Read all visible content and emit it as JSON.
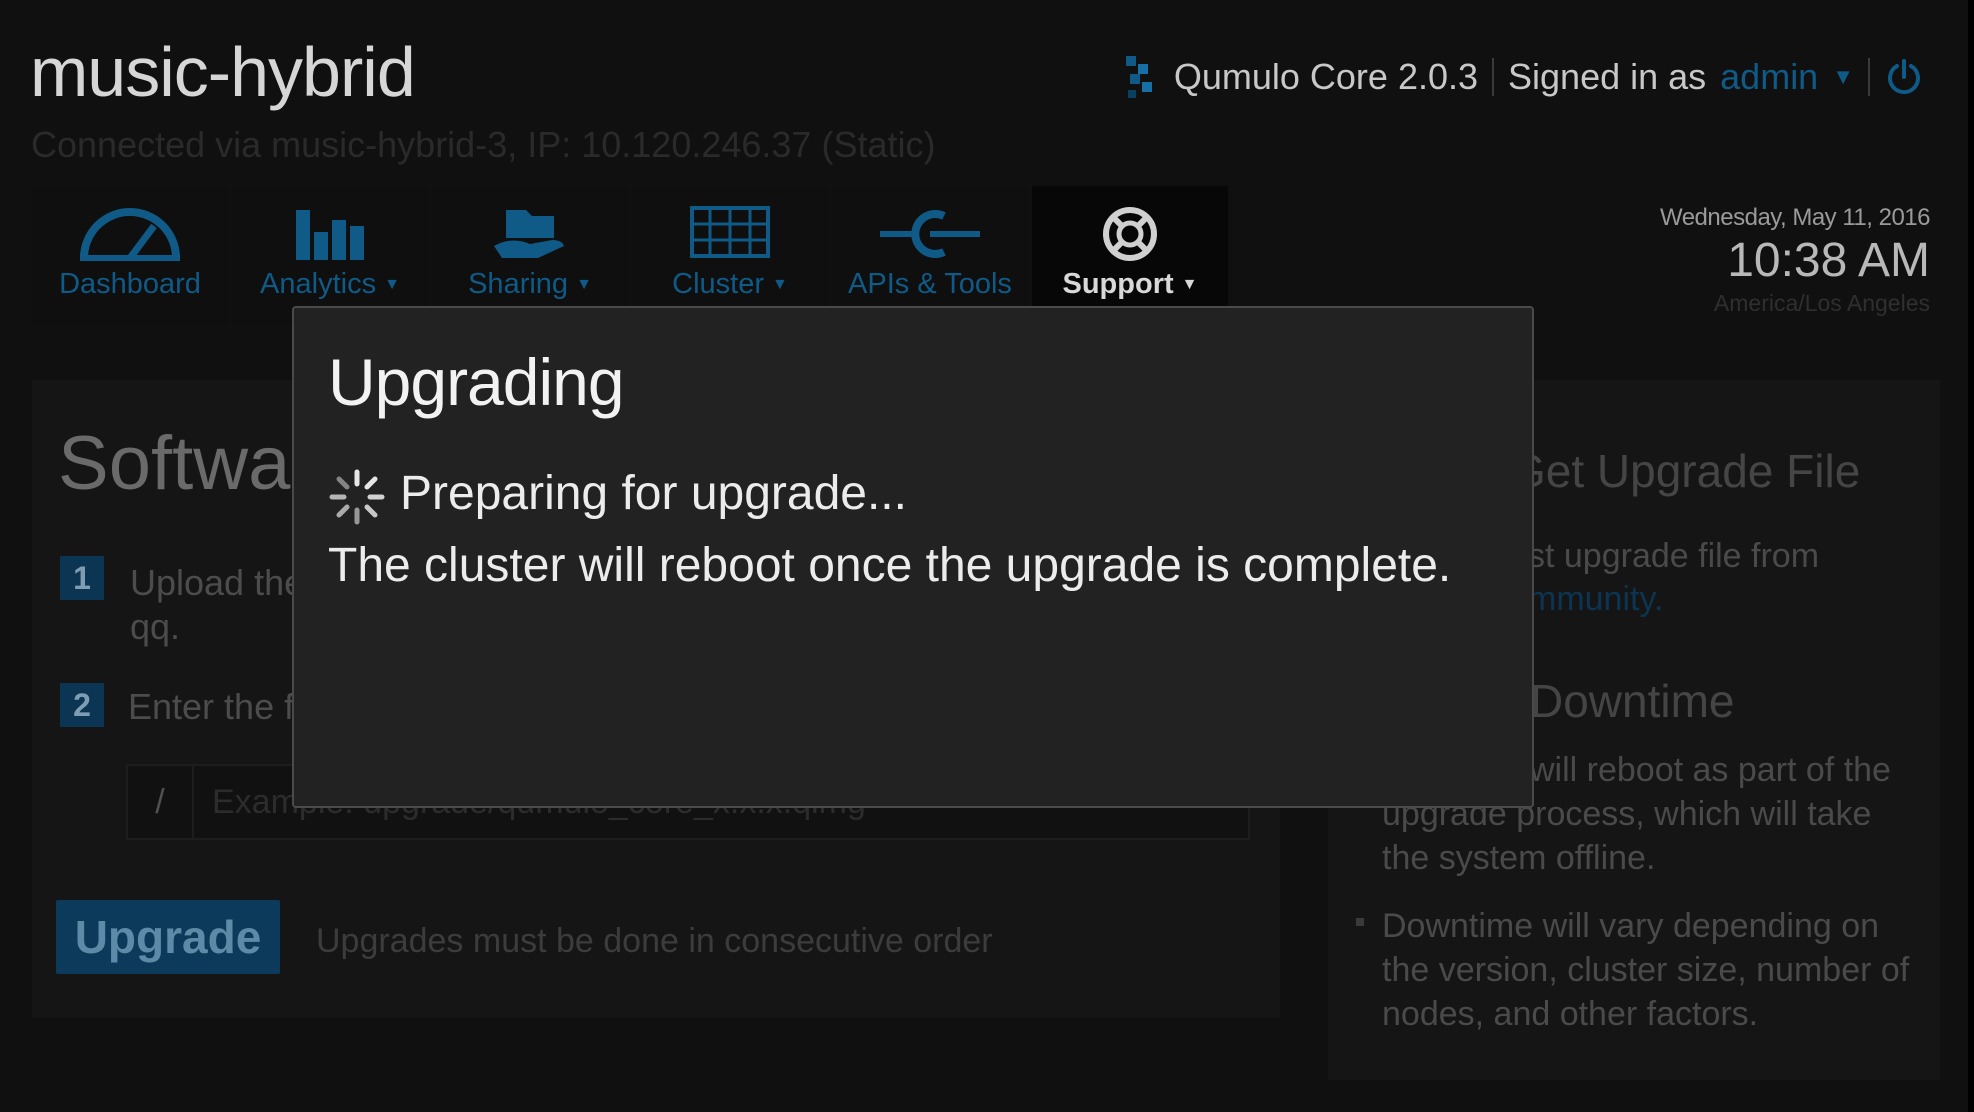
{
  "header": {
    "cluster_name": "music-hybrid",
    "connection": "Connected via music-hybrid-3, IP: 10.120.246.37 (Static)",
    "product": "Qumulo Core 2.0.3",
    "signed_in_label": "Signed in as",
    "user": "admin"
  },
  "nav": {
    "items": [
      {
        "label": "Dashboard",
        "icon": "gauge-icon"
      },
      {
        "label": "Analytics",
        "icon": "bar-chart-icon"
      },
      {
        "label": "Sharing",
        "icon": "folder-hand-icon"
      },
      {
        "label": "Cluster",
        "icon": "server-rack-icon"
      },
      {
        "label": "APIs & Tools",
        "icon": "plug-icon"
      },
      {
        "label": "Support",
        "icon": "lifebuoy-icon"
      }
    ],
    "active": "Support"
  },
  "clock": {
    "date": "Wednesday, May 11, 2016",
    "time": "10:38 AM",
    "timezone": "America/Los Angeles"
  },
  "background": {
    "title": "Software",
    "step1_number": "1",
    "step1_text_a": "Upload the",
    "step1_text_b": "qq.",
    "step2_number": "2",
    "step2_text": "Enter the fil",
    "path_prefix": "/",
    "path_placeholder": "Example: upgrade/qumulo_core_x.x.x.qimg",
    "upgrade_button": "Upgrade",
    "upgrade_note": "Upgrades must be done in consecutive order",
    "right_heading1": "Get Upgrade File",
    "right_text1": "st upgrade file from",
    "right_link1": "mmunity.",
    "right_heading2": "Downtime",
    "right_text2_a": "will reboot as part of the",
    "right_text2_b": "upgrade process, which will take",
    "right_text2_c": "the system offline.",
    "right_text3_a": "Downtime will vary depending on",
    "right_text3_b": "the version, cluster size, number of",
    "right_text3_c": "nodes, and other factors."
  },
  "modal": {
    "title": "Upgrading",
    "status": "Preparing for upgrade...",
    "message": "The cluster will reboot once the upgrade is complete."
  },
  "colors": {
    "accent": "#0f5a86",
    "modal_bg": "#222222",
    "page_bg": "#101010"
  }
}
